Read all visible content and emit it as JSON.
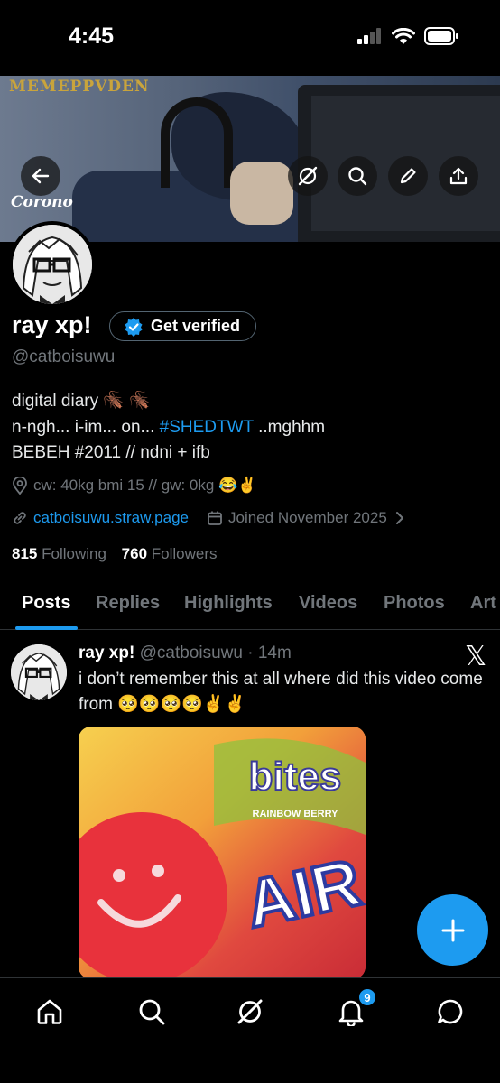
{
  "status_bar": {
    "time": "4:45"
  },
  "banner": {
    "sign_text": "MEMEPPVDEN",
    "corona_text": "Corono"
  },
  "profile": {
    "display_name": "ray xp!",
    "verify_label": "Get verified",
    "handle": "@catboisuwu",
    "bio_line1_text": "digital diary",
    "bio_line1_emoji": "🪳 🪳",
    "bio_line2_pre": "n-ngh... i-im... on... ",
    "bio_line2_link": "#SHEDTWT",
    "bio_line2_post": " ..mghhm",
    "bio_line3": "BEBEH #2011 // ndni + ifb",
    "location": "cw: 40kg bmi 15 // gw: 0kg 😂✌️",
    "website": "catboisuwu.straw.page",
    "joined": "Joined November 2025",
    "following_count": "815",
    "following_label": "Following",
    "followers_count": "760",
    "followers_label": "Followers"
  },
  "tabs": [
    "Posts",
    "Replies",
    "Highlights",
    "Videos",
    "Photos",
    "Art"
  ],
  "active_tab": "Posts",
  "post": {
    "author": "ray xp!",
    "handle": "@catboisuwu",
    "time": "· 14m",
    "text": "i don’t remember this at all where did this video come from 🥺🥺🥺🥺✌️✌️",
    "media_brand_top": "bites",
    "media_brand_sub": "RAINBOW BERRY",
    "media_brand_main": "AIR"
  },
  "nav": {
    "notification_count": "9"
  },
  "colors": {
    "accent": "#1d9bf0",
    "background": "#000000",
    "muted": "#71767b"
  }
}
